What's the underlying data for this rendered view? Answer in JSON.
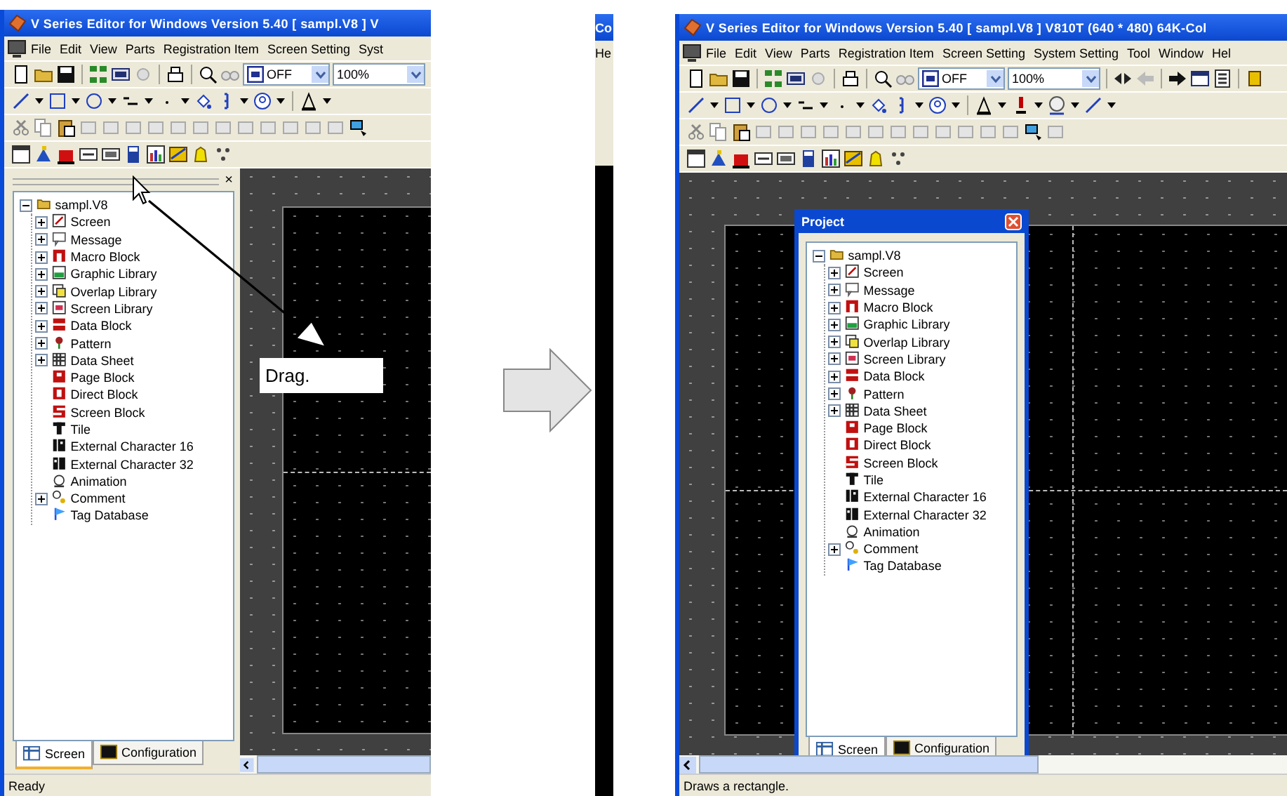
{
  "windows": [
    {
      "kind": "docked",
      "title": "V Series Editor for Windows Version 5.40 [ sampl.V8 ] V",
      "menu": [
        "File",
        "Edit",
        "View",
        "Parts",
        "Registration Item",
        "Screen Setting",
        "Syst"
      ],
      "display_dropdown": {
        "value": "OFF"
      },
      "zoom_dropdown": {
        "value": "100%"
      },
      "project": {
        "close_label": "×",
        "tree": {
          "label": "sampl.V8",
          "expanded": true,
          "children": [
            {
              "label": "Screen",
              "expanded": false
            },
            {
              "label": "Message",
              "expanded": false
            },
            {
              "label": "Macro Block",
              "expanded": false
            },
            {
              "label": "Graphic Library",
              "expanded": false
            },
            {
              "label": "Overlap Library",
              "expanded": false
            },
            {
              "label": "Screen Library",
              "expanded": false
            },
            {
              "label": "Data Block",
              "expanded": false
            },
            {
              "label": "Pattern",
              "expanded": false
            },
            {
              "label": "Data Sheet",
              "expanded": false
            },
            {
              "label": "Page Block"
            },
            {
              "label": "Direct Block"
            },
            {
              "label": "Screen Block"
            },
            {
              "label": "Tile"
            },
            {
              "label": "External Character 16"
            },
            {
              "label": "External Character 32"
            },
            {
              "label": "Animation"
            },
            {
              "label": "Comment",
              "expanded": false
            },
            {
              "label": "Tag Database"
            }
          ]
        },
        "tabs": [
          {
            "label": "Screen",
            "selected": true
          },
          {
            "label": "Configuration",
            "selected": false
          }
        ]
      },
      "status_bar": "Ready"
    },
    {
      "kind": "floating",
      "title": "V Series Editor for Windows Version 5.40 [ sampl.V8 ] V810T (640 * 480) 64K-Col",
      "menu": [
        "File",
        "Edit",
        "View",
        "Parts",
        "Registration Item",
        "Screen Setting",
        "System Setting",
        "Tool",
        "Window",
        "Hel"
      ],
      "display_dropdown": {
        "value": "OFF"
      },
      "zoom_dropdown": {
        "value": "100%"
      },
      "project": {
        "title": "Project",
        "tree": {
          "label": "sampl.V8",
          "expanded": true,
          "children": [
            {
              "label": "Screen",
              "expanded": false
            },
            {
              "label": "Message",
              "expanded": false
            },
            {
              "label": "Macro Block",
              "expanded": false
            },
            {
              "label": "Graphic Library",
              "expanded": false
            },
            {
              "label": "Overlap Library",
              "expanded": false
            },
            {
              "label": "Screen Library",
              "expanded": false
            },
            {
              "label": "Data Block",
              "expanded": false
            },
            {
              "label": "Pattern",
              "expanded": false
            },
            {
              "label": "Data Sheet",
              "expanded": false
            },
            {
              "label": "Page Block"
            },
            {
              "label": "Direct Block"
            },
            {
              "label": "Screen Block"
            },
            {
              "label": "Tile"
            },
            {
              "label": "External Character 16"
            },
            {
              "label": "External Character 32"
            },
            {
              "label": "Animation"
            },
            {
              "label": "Comment",
              "expanded": false
            },
            {
              "label": "Tag Database"
            }
          ]
        },
        "tabs": [
          {
            "label": "Screen",
            "selected": true
          },
          {
            "label": "Configuration",
            "selected": false
          }
        ]
      },
      "status_bar": "Draws a rectangle."
    }
  ],
  "annotation": {
    "label": "Drag."
  },
  "sliver": {
    "title": "Co",
    "menu": "He"
  }
}
